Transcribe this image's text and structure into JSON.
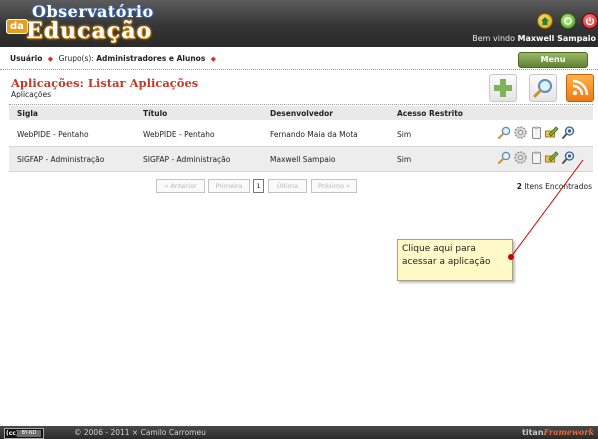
{
  "header": {
    "logo_line1": "Observatório",
    "logo_line2": "Educação",
    "logo_prefix": "da",
    "welcome_prefix": "Bem vindo",
    "welcome_user": "Maxwell Sampaio"
  },
  "userbar": {
    "user_label": "Usuário",
    "groups_label": "Grupo(s):",
    "groups_value": "Administradores e Alunos",
    "menu_label": "Menu"
  },
  "page": {
    "title": "Aplicações: Listar Aplicações",
    "breadcrumb": "Aplicações"
  },
  "table": {
    "headers": [
      "Sigla",
      "Título",
      "Desenvolvedor",
      "Acesso Restrito"
    ],
    "rows": [
      [
        "WebPIDE - Pentaho",
        "WebPIDE - Pentaho",
        "Fernando Maia da Mota",
        "Sim"
      ],
      [
        "SIGFAP - Administração",
        "SIGFAP - Administração",
        "Maxwell Sampaio",
        "Sim"
      ]
    ]
  },
  "pagination": {
    "prev": "« Anterior",
    "first": "Primeira",
    "current": "1",
    "last": "Última",
    "next": "Próximo »",
    "count": "2",
    "count_label": "Itens Encontrados"
  },
  "callout": {
    "text": "Clique aqui para acessar a aplicação"
  },
  "footer": {
    "cc_a": "(cc)",
    "cc_b": "BY-ND",
    "copyright": "© 2006 - 2011 × Camilo Carromeu",
    "fw1": "titan",
    "fw2": "Framework"
  },
  "colors": {
    "title": "#c0392b",
    "menu": "#6f9139",
    "callout_bg": "#fff9c8",
    "callout_arrow": "#cc0000"
  },
  "icons": {
    "header": [
      "home-icon",
      "help-icon",
      "logout-icon"
    ],
    "toolbar": [
      "add-icon",
      "search-icon",
      "rss-icon"
    ],
    "row_actions": [
      "view-icon",
      "settings-icon",
      "clipboard-icon",
      "edit-icon",
      "access-icon"
    ]
  }
}
